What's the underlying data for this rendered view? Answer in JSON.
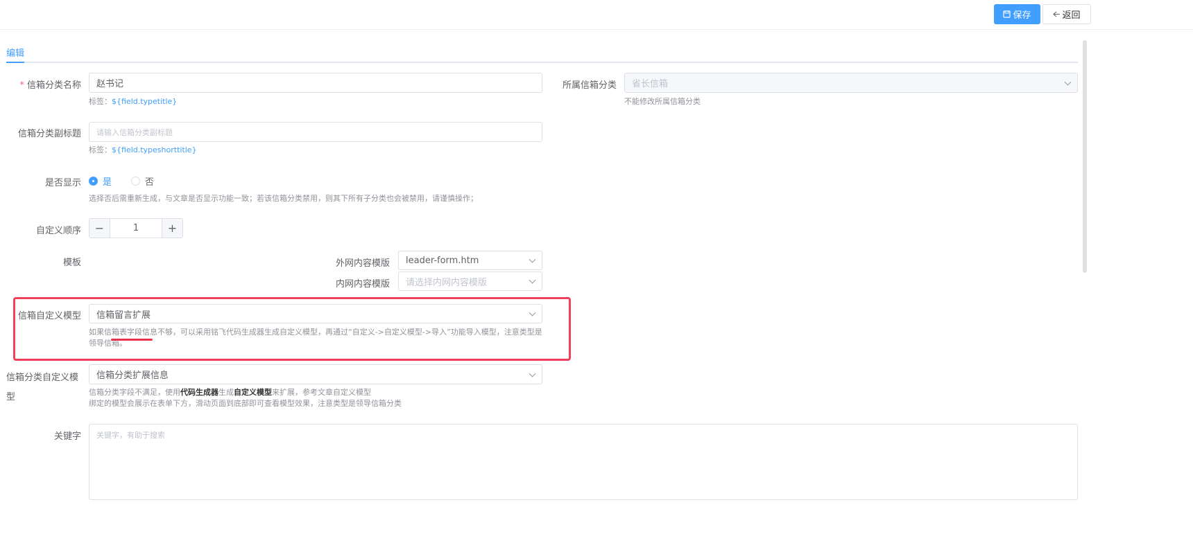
{
  "toolbar": {
    "save_label": "保存",
    "back_label": "返回"
  },
  "tabs": {
    "active": "编辑"
  },
  "form": {
    "name": {
      "label": "信箱分类名称",
      "value": "赵书记",
      "hint_prefix": "标签：",
      "hint_field": "${field.typetitle}"
    },
    "parent": {
      "label": "所属信箱分类",
      "value": "省长信箱",
      "hint": "不能修改所属信箱分类"
    },
    "subtitle": {
      "label": "信箱分类副标题",
      "placeholder": "请输入信箱分类副标题",
      "hint_prefix": "标签：",
      "hint_field": "${field.typeshorttitle}"
    },
    "display": {
      "label": "是否显示",
      "yes": "是",
      "no": "否",
      "hint": "选择否后需重新生成，与文章是否显示功能一致；若该信箱分类禁用，则其下所有子分类也会被禁用，请谨慎操作；"
    },
    "order": {
      "label": "自定义顺序",
      "minus": "−",
      "plus": "+",
      "value": "1"
    },
    "template": {
      "label": "模板",
      "outer_label": "外网内容模版",
      "outer_value": "leader-form.htm",
      "inner_label": "内网内容模版",
      "inner_placeholder": "请选择内网内容模版"
    },
    "mailbox_model": {
      "label": "信箱自定义模型",
      "value": "信箱留言扩展",
      "hint": "如果信箱表字段信息不够，可以采用铭飞代码生成器生成自定义模型，再通过“自定义->自定义模型->导入”功能导入模型，注意类型是领导信箱。"
    },
    "category_model": {
      "label_line1": "信箱分类自定义模",
      "label_line2": "型",
      "value": "信箱分类扩展信息",
      "hint1_a": "信箱分类字段不满足，使用",
      "hint1_b": "代码生成器",
      "hint1_c": "生成",
      "hint1_d": "自定义模型",
      "hint1_e": "来扩展，参考文章自定义模型",
      "hint2": "绑定的模型会展示在表单下方，滑动页面到底部即可查看模型效果，注意类型是领导信箱分类"
    },
    "keywords": {
      "label": "关键字",
      "placeholder": "关键字，有助于搜索"
    }
  },
  "colors": {
    "primary": "#409eff",
    "highlight": "#f0405c",
    "required": "#f56c6c"
  }
}
